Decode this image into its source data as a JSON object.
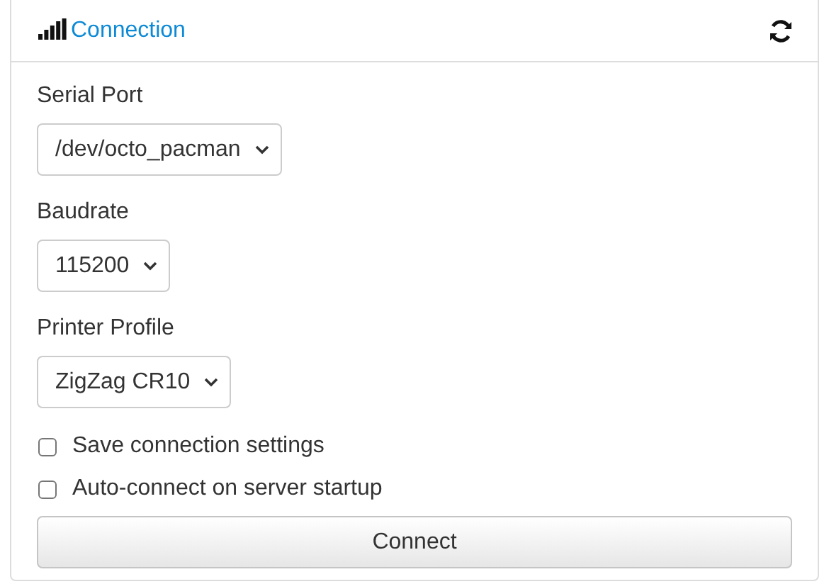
{
  "panel": {
    "title": "Connection"
  },
  "fields": [
    {
      "label": "Serial Port",
      "value": "/dev/octo_pacman"
    },
    {
      "label": "Baudrate",
      "value": "115200"
    },
    {
      "label": "Printer Profile",
      "value": "ZigZag CR10"
    }
  ],
  "options": [
    {
      "label": "Save connection settings",
      "checked": false
    },
    {
      "label": "Auto-connect on server startup",
      "checked": false
    }
  ],
  "button": "Connect"
}
